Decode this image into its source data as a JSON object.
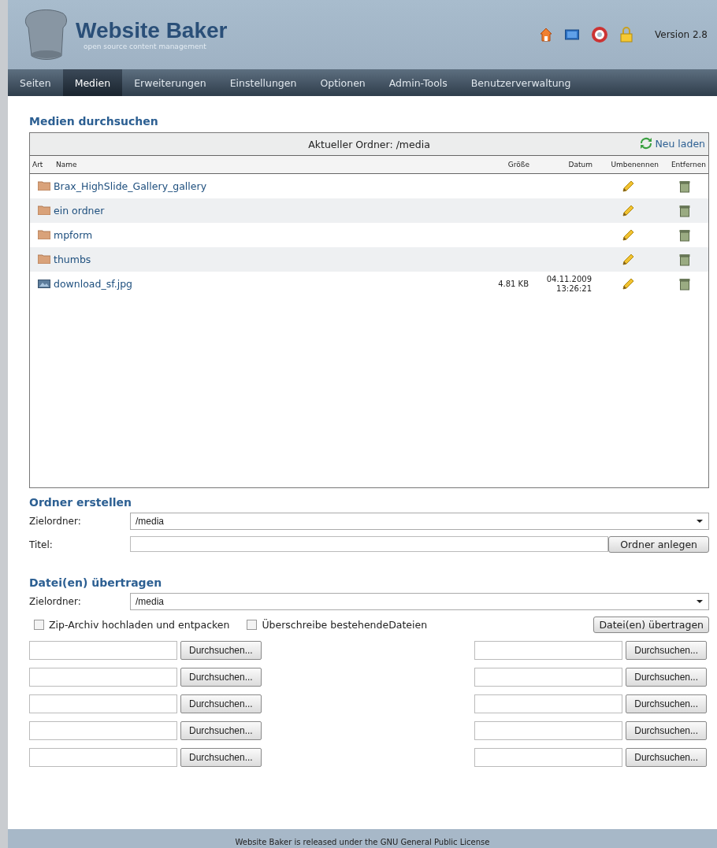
{
  "header": {
    "title": "Website Baker",
    "subtitle": "open source content management",
    "version": "Version 2.8"
  },
  "nav": [
    {
      "label": "Seiten",
      "selected": false
    },
    {
      "label": "Medien",
      "selected": true
    },
    {
      "label": "Erweiterungen",
      "selected": false
    },
    {
      "label": "Einstellungen",
      "selected": false
    },
    {
      "label": "Optionen",
      "selected": false
    },
    {
      "label": "Admin-Tools",
      "selected": false
    },
    {
      "label": "Benutzerverwaltung",
      "selected": false
    }
  ],
  "browser": {
    "heading": "Medien durchsuchen",
    "current_folder": "Aktueller Ordner: /media",
    "reload": "Neu laden",
    "columns": [
      "Art",
      "Name",
      "Größe",
      "Datum",
      "Umbenennen",
      "Entfernen"
    ],
    "rows": [
      {
        "kind": "folder",
        "name": "Brax_HighSlide_Gallery_gallery"
      },
      {
        "kind": "folder",
        "name": "ein ordner"
      },
      {
        "kind": "folder",
        "name": "mpform"
      },
      {
        "kind": "folder",
        "name": "thumbs"
      },
      {
        "kind": "file",
        "name": "download_sf.jpg",
        "size": "4.81 KB",
        "date": "04.11.2009",
        "time": "13:26:21"
      }
    ]
  },
  "create_folder": {
    "heading": "Ordner erstellen",
    "target_label": "Zielordner:",
    "target_value": "/media",
    "title_label": "Titel:",
    "button": "Ordner anlegen"
  },
  "upload": {
    "heading": "Datei(en) übertragen",
    "target_label": "Zielordner:",
    "target_value": "/media",
    "options": [
      {
        "label": "Zip-Archiv hochladen und entpacken",
        "checked": false
      },
      {
        "label": "Überschreibe bestehendeDateien",
        "checked": false
      }
    ],
    "button": "Datei(en) übertragen",
    "file_fields": [
      {
        "button": "Durchsuchen..."
      },
      {
        "button": "Durchsuchen..."
      },
      {
        "button": "Durchsuchen..."
      },
      {
        "button": "Durchsuchen..."
      },
      {
        "button": "Durchsuchen..."
      },
      {
        "button": "Durchsuchen..."
      },
      {
        "button": "Durchsuchen..."
      },
      {
        "button": "Durchsuchen..."
      },
      {
        "button": "Durchsuchen..."
      },
      {
        "button": "Durchsuchen..."
      }
    ]
  },
  "footer": "Website Baker is released under the GNU General Public License"
}
